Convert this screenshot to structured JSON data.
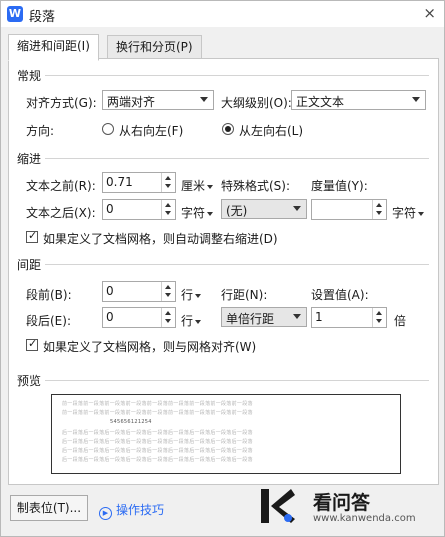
{
  "window": {
    "title": "段落",
    "app_icon_letter": "W",
    "close_glyph": "×"
  },
  "tabs": [
    {
      "label": "缩进和间距(I)",
      "active": true
    },
    {
      "label": "换行和分页(P)",
      "active": false
    }
  ],
  "general": {
    "heading": "常规",
    "alignment_label": "对齐方式(G):",
    "alignment_value": "两端对齐",
    "outline_label": "大纲级别(O):",
    "outline_value": "正文文本",
    "direction_label": "方向:",
    "rtl_label": "从右向左(F)",
    "ltr_label": "从左向右(L)",
    "direction_selected": "ltr"
  },
  "indent": {
    "heading": "缩进",
    "before_label": "文本之前(R):",
    "before_value": "0.71",
    "before_unit": "厘米",
    "after_label": "文本之后(X):",
    "after_value": "0",
    "after_unit": "字符",
    "special_label": "特殊格式(S):",
    "special_value": "(无)",
    "measure_label": "度量值(Y):",
    "measure_value": "",
    "measure_unit": "字符",
    "auto_adjust_label": "如果定义了文档网格，则自动调整右缩进(D)",
    "auto_adjust_checked": true
  },
  "spacing": {
    "heading": "间距",
    "before_label": "段前(B):",
    "before_value": "0",
    "before_unit": "行",
    "after_label": "段后(E):",
    "after_value": "0",
    "after_unit": "行",
    "line_label": "行距(N):",
    "line_value": "单倍行距",
    "setting_label": "设置值(A):",
    "setting_value": "1",
    "setting_unit": "倍",
    "snap_grid_label": "如果定义了文档网格，则与网格对齐(W)",
    "snap_grid_checked": true
  },
  "preview": {
    "heading": "预览",
    "filler": "前一段落前一段落前一段落前一段落前一段落前一段落前一段落前一段落前一段落",
    "sample": "545656121254",
    "after_filler": "后一段落后一段落后一段落后一段落后一段落后一段落后一段落后一段落后一段落"
  },
  "footer": {
    "tabs_button": "制表位(T)...",
    "tips_label": "操作技巧"
  },
  "watermark": {
    "text": "看问答",
    "url": "www.kanwenda.com"
  },
  "colors": {
    "accent": "#2b6bf3",
    "panel_bg": "#ffffff",
    "dialog_bg": "#f0f0f0"
  }
}
